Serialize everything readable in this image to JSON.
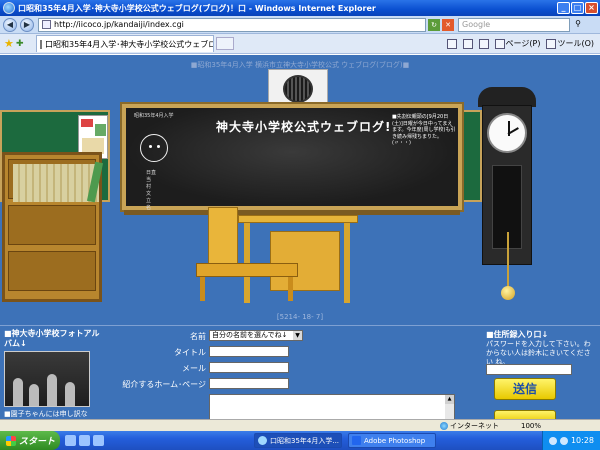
{
  "browser": {
    "title": "口昭和35年4月入学･神大寺小学校公式ウェブログ(ブログ)！口 - Windows Internet Explorer",
    "address": "http://iicoco.jp/kandaiji/index.cgi",
    "search_placeholder": "Google",
    "tab_label": "口昭和35年4月入学･神大寺小学校公式ウェブログ(...",
    "cmd_page": "ページ(P)",
    "cmd_tools": "ツール(O)"
  },
  "page": {
    "header": "■昭和35年4月入学  横浜市立神大寺小学校公式  ウェブログ(ブログ)■",
    "blackboard": {
      "date_line": "昭和35年4月入学",
      "title": "神大寺小学校公式ウェブログ!",
      "notice": "■先割伝親頭の[9月20日(土)]日曜が今日中ってまえます。今年度(周し学校)も引き続み帰残ちまりた。(〃・・)",
      "signs": "日直\n当\n村\n文\n立\n名"
    },
    "counter": "[5214- 18- 7]",
    "album": {
      "title": "■神大寺小学校フォトアルバム↓",
      "caption": "■園子ちゃんには申し訳な"
    },
    "form": {
      "name_label": "名前",
      "name_select": "自分の名前を選んでね↓",
      "title_label": "タイトル",
      "mail_label": "メール",
      "homepage_label": "紹介するホーム･ページ"
    },
    "address_entry": {
      "title": "■住所録入り口↓",
      "note": "パスワードを入力して下さい。わからない人は鈴木にきいてください ね。",
      "send_label": "送信"
    }
  },
  "statusbar": {
    "zone": "インターネット",
    "zoom": "100%"
  },
  "taskbar": {
    "start_label": "スタート",
    "items": [
      "口昭和35年4月入学...",
      "Adobe Photoshop"
    ],
    "clock": "10:28"
  }
}
